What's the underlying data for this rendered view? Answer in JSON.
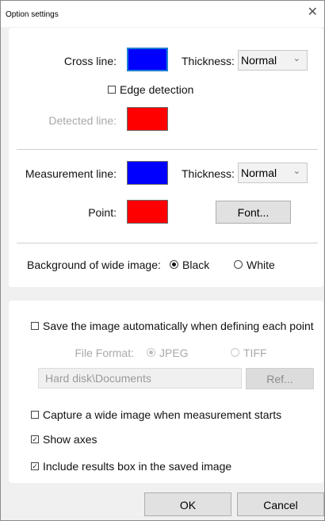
{
  "window": {
    "title": "Option settings",
    "close_glyph": "✕"
  },
  "lines": {
    "cross_line_label": "Cross line:",
    "thickness_label": "Thickness:",
    "cross_thickness": "Normal",
    "edge_detection_label": "Edge detection",
    "edge_detection_checked": false,
    "detected_line_label": "Detected line:",
    "measurement_line_label": "Measurement line:",
    "measurement_thickness": "Normal",
    "point_label": "Point:",
    "font_button": "Font...",
    "colors": {
      "cross_line": "#0000ff",
      "detected_line": "#ff0000",
      "measurement_line": "#0000ff",
      "point": "#ff0000"
    }
  },
  "background": {
    "label": "Background of wide image:",
    "black_label": "Black",
    "white_label": "White",
    "selected": "Black"
  },
  "save": {
    "auto_save_label": "Save the image automatically when defining each point",
    "auto_save_checked": false,
    "file_format_label": "File Format:",
    "jpeg_label": "JPEG",
    "tiff_label": "TIFF",
    "selected_format": "JPEG",
    "path_value": "Hard disk\\Documents",
    "ref_button": "Ref...",
    "capture_wide_label": "Capture a wide image when measurement starts",
    "capture_wide_checked": false,
    "show_axes_label": "Show axes",
    "show_axes_checked": true,
    "include_results_label": "Include results box in the saved image",
    "include_results_checked": true
  },
  "footer": {
    "ok": "OK",
    "cancel": "Cancel"
  },
  "icons": {
    "dropdown": "chevron-down-icon",
    "checkmark": "✓"
  }
}
